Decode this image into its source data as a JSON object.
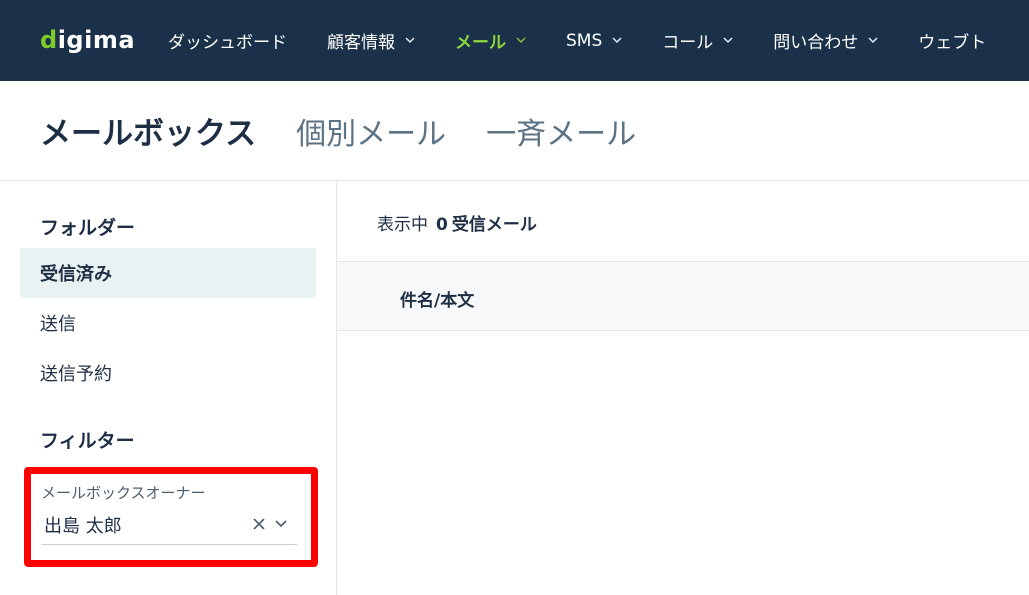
{
  "brand": {
    "logo_text": "digima",
    "logo_accent": "d",
    "accent_color": "#8bd63a"
  },
  "nav": {
    "items": [
      {
        "label": "ダッシュボード",
        "has_dropdown": false,
        "active": false
      },
      {
        "label": "顧客情報",
        "has_dropdown": true,
        "active": false
      },
      {
        "label": "メール",
        "has_dropdown": true,
        "active": true
      },
      {
        "label": "SMS",
        "has_dropdown": true,
        "active": false
      },
      {
        "label": "コール",
        "has_dropdown": true,
        "active": false
      },
      {
        "label": "問い合わせ",
        "has_dropdown": true,
        "active": false
      },
      {
        "label": "ウェブト",
        "has_dropdown": false,
        "active": false
      }
    ],
    "background_color": "#1a3149"
  },
  "header": {
    "title": "メールボックス",
    "links": [
      "個別メール",
      "一斉メール"
    ]
  },
  "sidebar": {
    "folders_heading": "フォルダー",
    "folders": [
      {
        "label": "受信済み",
        "active": true
      },
      {
        "label": "送信",
        "active": false
      },
      {
        "label": "送信予約",
        "active": false
      }
    ],
    "filters_heading": "フィルター",
    "owner_filter": {
      "label": "メールボックスオーナー",
      "value": "出島 太郎",
      "highlight_color": "#ff0000"
    }
  },
  "main": {
    "status_prefix": "表示中",
    "count": "0",
    "folder_name": "受信メール",
    "table_columns": [
      "件名/本文"
    ]
  },
  "icons": {
    "chevron_down": "⌄",
    "clear": "✕"
  }
}
